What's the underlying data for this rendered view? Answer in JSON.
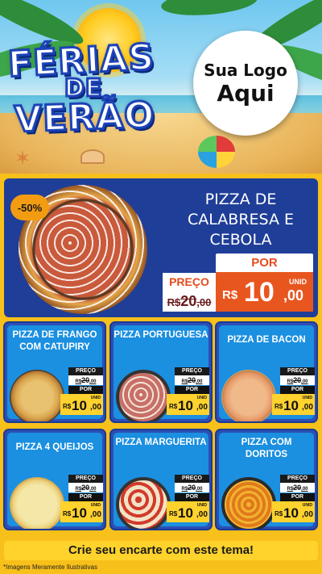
{
  "hero": {
    "title_line1": "FÉRIAS",
    "title_line2": "DE",
    "title_line3": "VERÃO",
    "logo_line1": "Sua Logo",
    "logo_line2": "Aqui"
  },
  "featured": {
    "discount": "-50%",
    "name": "PIZZA DE CALABRESA E CEBOLA",
    "preco_label": "PREÇO",
    "por_label": "POR",
    "old_currency": "R$",
    "old_value": "20",
    "old_cents": ",00",
    "new_currency": "R$",
    "new_value": "10",
    "new_cents": ",00",
    "unit": "UNID"
  },
  "products": [
    {
      "name": "PIZZA DE FRANGO COM CATUPIRY",
      "preco_label": "PREÇO",
      "old_currency": "R$",
      "old_value": "20",
      "old_cents": ",00",
      "por_label": "POR",
      "new_currency": "R$",
      "new_value": "10",
      "new_cents": ",00",
      "unit": "UNID"
    },
    {
      "name": "PIZZA PORTUGUESA",
      "preco_label": "PREÇO",
      "old_currency": "R$",
      "old_value": "20",
      "old_cents": ",00",
      "por_label": "POR",
      "new_currency": "R$",
      "new_value": "10",
      "new_cents": ",00",
      "unit": "UNID"
    },
    {
      "name": "PIZZA DE BACON",
      "preco_label": "PREÇO",
      "old_currency": "R$",
      "old_value": "20",
      "old_cents": ",00",
      "por_label": "POR",
      "new_currency": "R$",
      "new_value": "10",
      "new_cents": ",00",
      "unit": "UNID"
    },
    {
      "name": "PIZZA 4 QUEIJOS",
      "preco_label": "PREÇO",
      "old_currency": "R$",
      "old_value": "20",
      "old_cents": ",00",
      "por_label": "POR",
      "new_currency": "R$",
      "new_value": "10",
      "new_cents": ",00",
      "unit": "UNID"
    },
    {
      "name": "PIZZA MARGUERITA",
      "preco_label": "PREÇO",
      "old_currency": "R$",
      "old_value": "20",
      "old_cents": ",00",
      "por_label": "POR",
      "new_currency": "R$",
      "new_value": "10",
      "new_cents": ",00",
      "unit": "UNID"
    },
    {
      "name": "PIZZA COM DORITOS",
      "preco_label": "PREÇO",
      "old_currency": "R$",
      "old_value": "20",
      "old_cents": ",00",
      "por_label": "POR",
      "new_currency": "R$",
      "new_value": "10",
      "new_cents": ",00",
      "unit": "UNID"
    }
  ],
  "cta": "Crie seu encarte com este tema!",
  "disclaimer": "*Imagens Meramente Ilustrativas",
  "colors": {
    "background": "#f8c01a",
    "featured_panel": "#1f3e98",
    "card_blue": "#1b8fe0",
    "price_orange": "#e8561f",
    "price_yellow": "#ffd22e"
  }
}
